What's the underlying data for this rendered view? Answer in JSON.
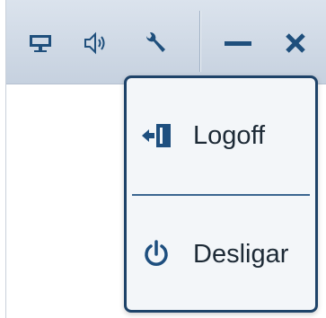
{
  "toolbar": {
    "icons": [
      "monitor-icon",
      "speaker-icon",
      "wrench-icon",
      "minimize-icon",
      "close-icon"
    ]
  },
  "menu": {
    "items": [
      {
        "label": "Logoff",
        "icon": "logoff-icon"
      },
      {
        "label": "Desligar",
        "icon": "power-icon"
      }
    ]
  },
  "colors": {
    "accent": "#1e4369",
    "icon": "#1f4f7c",
    "toolbar_bg": "#cdd7e4",
    "menu_bg": "#f3f6f9"
  }
}
